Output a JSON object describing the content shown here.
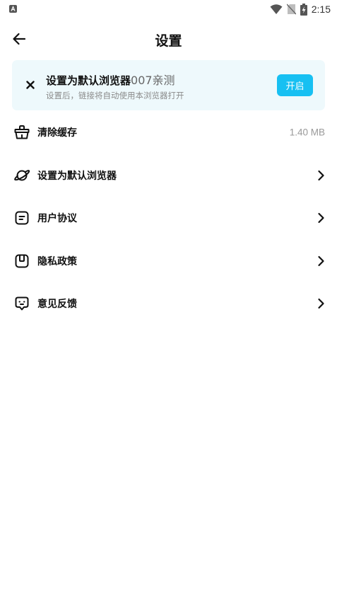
{
  "status_bar": {
    "time": "2:15"
  },
  "header": {
    "title": "设置"
  },
  "banner": {
    "title": "设置为默认浏览器",
    "title_suffix": "007亲测",
    "subtitle": "设置后，链接将自动使用本浏览器打开",
    "button_label": "开启",
    "button_color": "#17c0f2",
    "background_color": "#eef9fc"
  },
  "menu": {
    "items": [
      {
        "label": "清除缓存",
        "value": "1.40 MB",
        "icon": "broom-icon"
      },
      {
        "label": "设置为默认浏览器",
        "icon": "planet-icon"
      },
      {
        "label": "用户协议",
        "icon": "document-icon"
      },
      {
        "label": "隐私政策",
        "icon": "privacy-icon"
      },
      {
        "label": "意见反馈",
        "icon": "feedback-icon"
      }
    ]
  }
}
